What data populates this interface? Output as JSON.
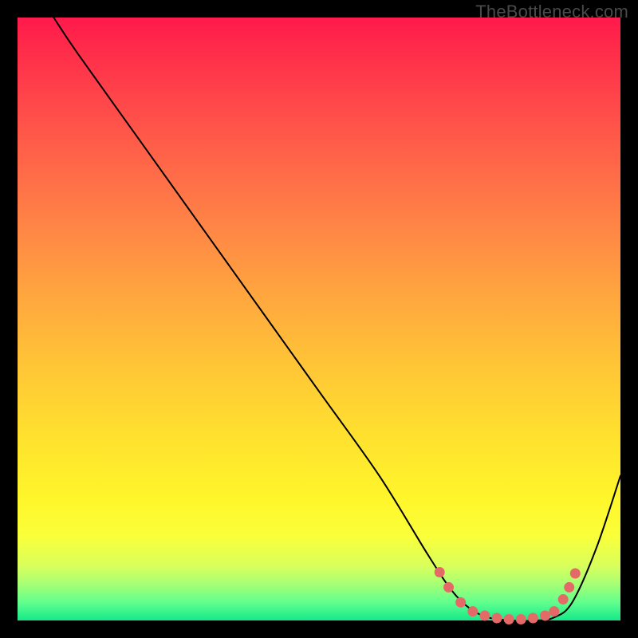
{
  "attribution": "TheBottleneck.com",
  "chart_data": {
    "type": "line",
    "title": "",
    "xlabel": "",
    "ylabel": "",
    "xlim": [
      0,
      100
    ],
    "ylim": [
      0,
      100
    ],
    "series": [
      {
        "name": "curve",
        "x": [
          6,
          10,
          20,
          30,
          40,
          50,
          60,
          68,
          72,
          75,
          78,
          82,
          86,
          89,
          92,
          96,
          100
        ],
        "y": [
          100,
          94,
          80,
          66,
          52,
          38,
          24,
          11,
          5,
          2,
          0.5,
          0,
          0,
          0.5,
          3,
          12,
          24
        ]
      }
    ],
    "markers": {
      "name": "highlight-dots",
      "color": "#e46a68",
      "points": [
        {
          "x": 70.0,
          "y": 8.0
        },
        {
          "x": 71.5,
          "y": 5.5
        },
        {
          "x": 73.5,
          "y": 3.0
        },
        {
          "x": 75.5,
          "y": 1.5
        },
        {
          "x": 77.5,
          "y": 0.8
        },
        {
          "x": 79.5,
          "y": 0.4
        },
        {
          "x": 81.5,
          "y": 0.2
        },
        {
          "x": 83.5,
          "y": 0.2
        },
        {
          "x": 85.5,
          "y": 0.4
        },
        {
          "x": 87.5,
          "y": 0.8
        },
        {
          "x": 89.0,
          "y": 1.5
        },
        {
          "x": 90.5,
          "y": 3.5
        },
        {
          "x": 91.5,
          "y": 5.5
        },
        {
          "x": 92.5,
          "y": 7.8
        }
      ]
    }
  }
}
